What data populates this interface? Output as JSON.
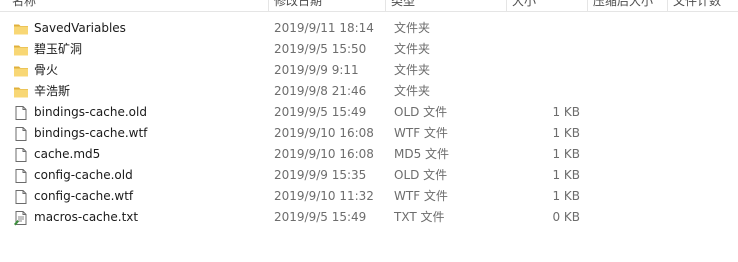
{
  "columns": {
    "name": "名称",
    "date": "修改日期",
    "type": "类型",
    "size": "大小",
    "compressed": "压缩后大小",
    "extra": "文件计数"
  },
  "files": [
    {
      "name": "SavedVariables",
      "date": "2019/9/11 18:14",
      "type": "文件夹",
      "size": "",
      "icon": "folder-icon"
    },
    {
      "name": "碧玉矿洞",
      "date": "2019/9/5 15:50",
      "type": "文件夹",
      "size": "",
      "icon": "folder-icon"
    },
    {
      "name": "骨火",
      "date": "2019/9/9 9:11",
      "type": "文件夹",
      "size": "",
      "icon": "folder-icon"
    },
    {
      "name": "辛浩斯",
      "date": "2019/9/8 21:46",
      "type": "文件夹",
      "size": "",
      "icon": "folder-icon"
    },
    {
      "name": "bindings-cache.old",
      "date": "2019/9/5 15:49",
      "type": "OLD 文件",
      "size": "1 KB",
      "icon": "file-icon"
    },
    {
      "name": "bindings-cache.wtf",
      "date": "2019/9/10 16:08",
      "type": "WTF 文件",
      "size": "1 KB",
      "icon": "file-icon"
    },
    {
      "name": "cache.md5",
      "date": "2019/9/10 16:08",
      "type": "MD5 文件",
      "size": "1 KB",
      "icon": "file-icon"
    },
    {
      "name": "config-cache.old",
      "date": "2019/9/9 15:35",
      "type": "OLD 文件",
      "size": "1 KB",
      "icon": "file-icon"
    },
    {
      "name": "config-cache.wtf",
      "date": "2019/9/10 11:32",
      "type": "WTF 文件",
      "size": "1 KB",
      "icon": "file-icon"
    },
    {
      "name": "macros-cache.txt",
      "date": "2019/9/5 15:49",
      "type": "TXT 文件",
      "size": "0 KB",
      "icon": "text-file-icon"
    }
  ],
  "colors": {
    "folder": "#f8d775",
    "folder_dark": "#e0b03c",
    "header_text": "#4d4d4d",
    "secondary_text": "#6d6d6d"
  }
}
